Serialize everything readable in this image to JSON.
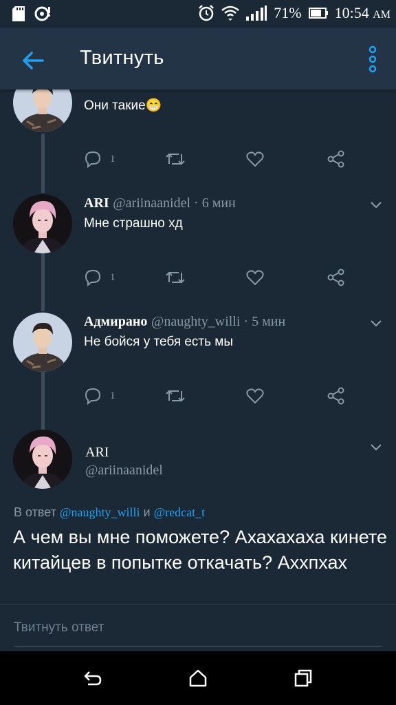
{
  "status_bar": {
    "battery": "71%",
    "time": "10:54",
    "ampm": "AM"
  },
  "app_bar": {
    "title": "Твитнуть"
  },
  "thread": [
    {
      "text": "Они такие😁",
      "reply_count": "1"
    },
    {
      "name": "ARI",
      "handle": "@ariinaanidel · 6 мин",
      "text": "Мне страшно хд",
      "reply_count": "1"
    },
    {
      "name": "Адмирано",
      "handle": "@naughty_willi · 5 мин",
      "text": "Не бойся у тебя есть мы",
      "reply_count": "1"
    }
  ],
  "main_tweet": {
    "name": "ARI",
    "handle": "@ariinaanidel",
    "reply_prefix": "В ответ",
    "reply_user_1": "@naughty_willi",
    "reply_and": "и",
    "reply_user_2": "@redcat_t",
    "text": "А чем вы мне поможете? Ахахахаха кинете китайцев в попытке откачать? Аххпхах"
  },
  "reply_bar": {
    "placeholder": "Твитнуть ответ"
  },
  "colors": {
    "background": "#1b2836",
    "app_bar": "#243447",
    "accent": "#1da1f2",
    "secondary_text": "#8899a6"
  }
}
